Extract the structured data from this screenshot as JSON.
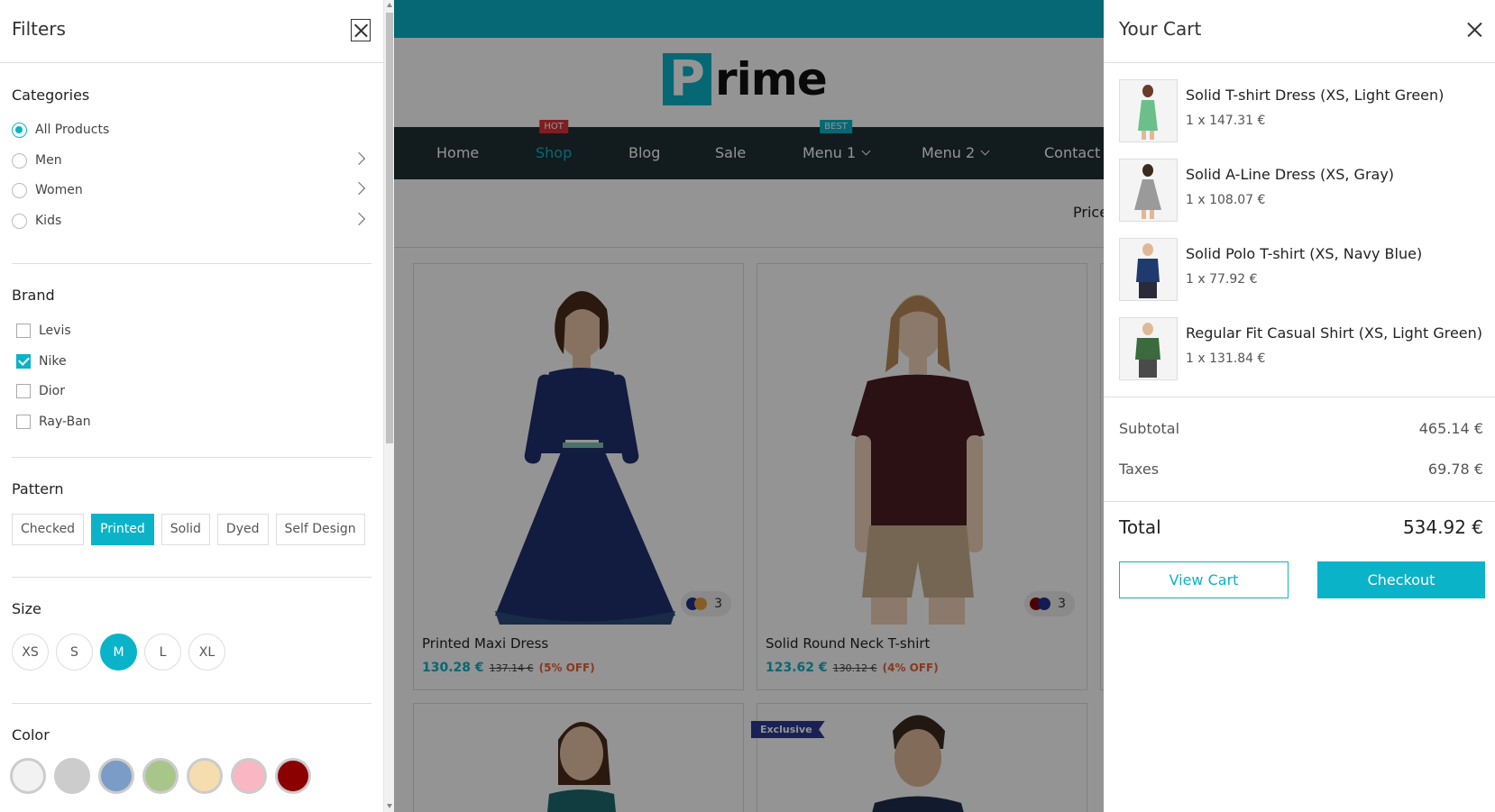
{
  "store": {
    "logo_letter": "P",
    "logo_rest": "rime",
    "nav": [
      {
        "label": "Home",
        "badge": ""
      },
      {
        "label": "Shop",
        "badge": "HOT"
      },
      {
        "label": "Blog",
        "badge": ""
      },
      {
        "label": "Sale",
        "badge": ""
      },
      {
        "label": "Menu 1",
        "badge": "BEST"
      },
      {
        "label": "Menu 2",
        "badge": ""
      },
      {
        "label": "Contact",
        "badge": ""
      }
    ],
    "sort_label": "Price",
    "products": [
      {
        "name": "Printed Maxi Dress",
        "price": "130.28 €",
        "old_price": "137.14 €",
        "off": "(5% OFF)",
        "variant_count": "3"
      },
      {
        "name": "Solid Round Neck T-shirt",
        "price": "123.62 €",
        "old_price": "130.12 €",
        "off": "(4% OFF)",
        "variant_count": "3"
      }
    ],
    "exclusive_label": "Exclusive"
  },
  "filters": {
    "title": "Filters",
    "categories": {
      "title": "Categories",
      "items": [
        {
          "label": "All Products",
          "checked": true
        },
        {
          "label": "Men",
          "checked": false
        },
        {
          "label": "Women",
          "checked": false
        },
        {
          "label": "Kids",
          "checked": false
        }
      ]
    },
    "brand": {
      "title": "Brand",
      "items": [
        {
          "label": "Levis",
          "checked": false
        },
        {
          "label": "Nike",
          "checked": true
        },
        {
          "label": "Dior",
          "checked": false
        },
        {
          "label": "Ray-Ban",
          "checked": false
        }
      ]
    },
    "pattern": {
      "title": "Pattern",
      "items": [
        "Checked",
        "Printed",
        "Solid",
        "Dyed",
        "Self Design"
      ],
      "active": "Printed"
    },
    "size": {
      "title": "Size",
      "items": [
        "XS",
        "S",
        "M",
        "L",
        "XL"
      ],
      "active": "M"
    },
    "color": {
      "title": "Color",
      "swatches": [
        "#f2f2f2",
        "#cccccc",
        "#7a9cc6",
        "#a8c68a",
        "#f5ddb0",
        "#fbb6c4",
        "#8b0000"
      ]
    }
  },
  "cart": {
    "title": "Your Cart",
    "items": [
      {
        "name": "Solid T-shirt Dress (XS, Light Green)",
        "qty": "1 x 147.31 €"
      },
      {
        "name": "Solid A-Line Dress (XS, Gray)",
        "qty": "1 x 108.07 €"
      },
      {
        "name": "Solid Polo T-shirt (XS, Navy Blue)",
        "qty": "1 x 77.92 €"
      },
      {
        "name": "Regular Fit Casual Shirt (XS, Light Green)",
        "qty": "1 x 131.84 €"
      }
    ],
    "subtotal_label": "Subtotal",
    "subtotal": "465.14 €",
    "taxes_label": "Taxes",
    "taxes": "69.78 €",
    "total_label": "Total",
    "total": "534.92 €",
    "view_cart": "View Cart",
    "checkout": "Checkout"
  },
  "colors": {
    "accent": "#0bb3c9",
    "nav_bg": "#1f2f33",
    "hot": "#d9353b",
    "discount": "#e8613c"
  }
}
